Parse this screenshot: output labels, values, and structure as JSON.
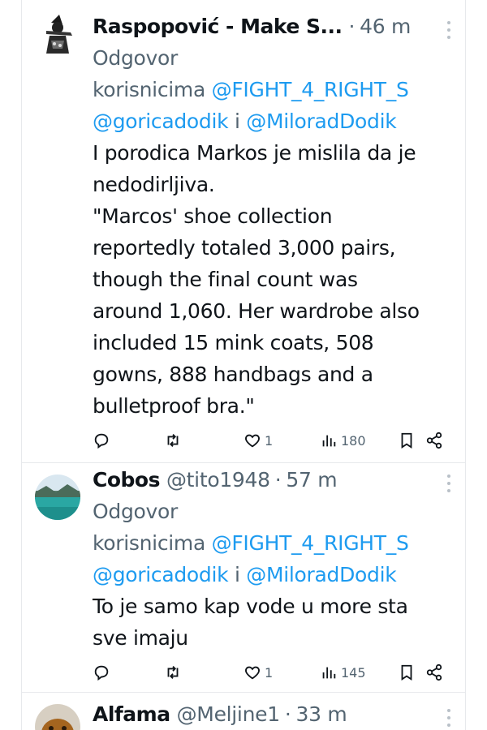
{
  "posts": [
    {
      "name": "Raspopović - Make S...",
      "handle": "",
      "time": "46 m",
      "reply_prefix": "Odgovor",
      "reply_to_word": "korisnicima",
      "mention1": "@FIGHT_4_RIGHT_S",
      "mention2": "@goricadodik",
      "conj": "i",
      "mention3": "@MiloradDodik",
      "text_lines": [
        "I porodica Markos je mislila da je",
        "nedodirljiva.",
        "\"Marcos' shoe collection",
        "reportedly totaled 3,000 pairs,",
        "though the final count was",
        "around 1,060. Her wardrobe also",
        "included 15 mink coats, 508",
        "gowns, 888 handbags and a",
        "bulletproof bra.\""
      ],
      "likes": "1",
      "views": "180"
    },
    {
      "name": "Cobos",
      "handle": "@tito1948",
      "time": "57 m",
      "reply_prefix": "Odgovor",
      "reply_to_word": "korisnicima",
      "mention1": "@FIGHT_4_RIGHT_S",
      "mention2": "@goricadodik",
      "conj": "i",
      "mention3": "@MiloradDodik",
      "text_lines": [
        "To je samo kap vode u more sta",
        "sve imaju"
      ],
      "likes": "1",
      "views": "145"
    },
    {
      "name": "Alfama",
      "handle": "@Meljine1",
      "time": "33 m"
    }
  ],
  "separator": "·",
  "icons": [
    "reply-icon",
    "retweet-icon",
    "like-icon",
    "views-icon",
    "bookmark-icon",
    "share-icon",
    "more-icon"
  ],
  "colors": {
    "link": "#1d9bf0",
    "secondary": "#536471",
    "text": "#0f1419"
  }
}
